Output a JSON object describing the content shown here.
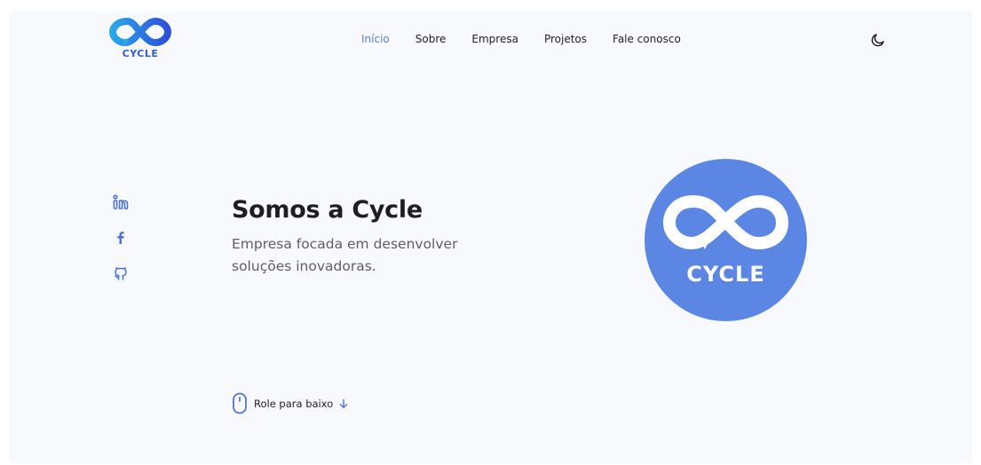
{
  "brand": {
    "logo_text": "CYCLE",
    "hero_logo_text": "CYCLE",
    "gradient_start": "#2aa7e8",
    "gradient_end": "#2e4fd9",
    "accent": "#5b86e3"
  },
  "nav": {
    "items": [
      {
        "label": "Início",
        "active": true
      },
      {
        "label": "Sobre",
        "active": false
      },
      {
        "label": "Empresa",
        "active": false
      },
      {
        "label": "Projetos",
        "active": false
      },
      {
        "label": "Fale conosco",
        "active": false
      }
    ],
    "active_color": "#5b7fd8",
    "theme_toggle_icon": "moon-icon"
  },
  "socials": [
    {
      "icon": "linkedin-icon"
    },
    {
      "icon": "facebook-icon"
    },
    {
      "icon": "github-icon"
    }
  ],
  "hero": {
    "title": "Somos a Cycle",
    "subtitle": "Empresa focada em desenvolver soluções inovadoras."
  },
  "scroll": {
    "label": "Role para baixo",
    "mouse_icon": "mouse-icon",
    "arrow_icon": "arrow-down-icon"
  }
}
